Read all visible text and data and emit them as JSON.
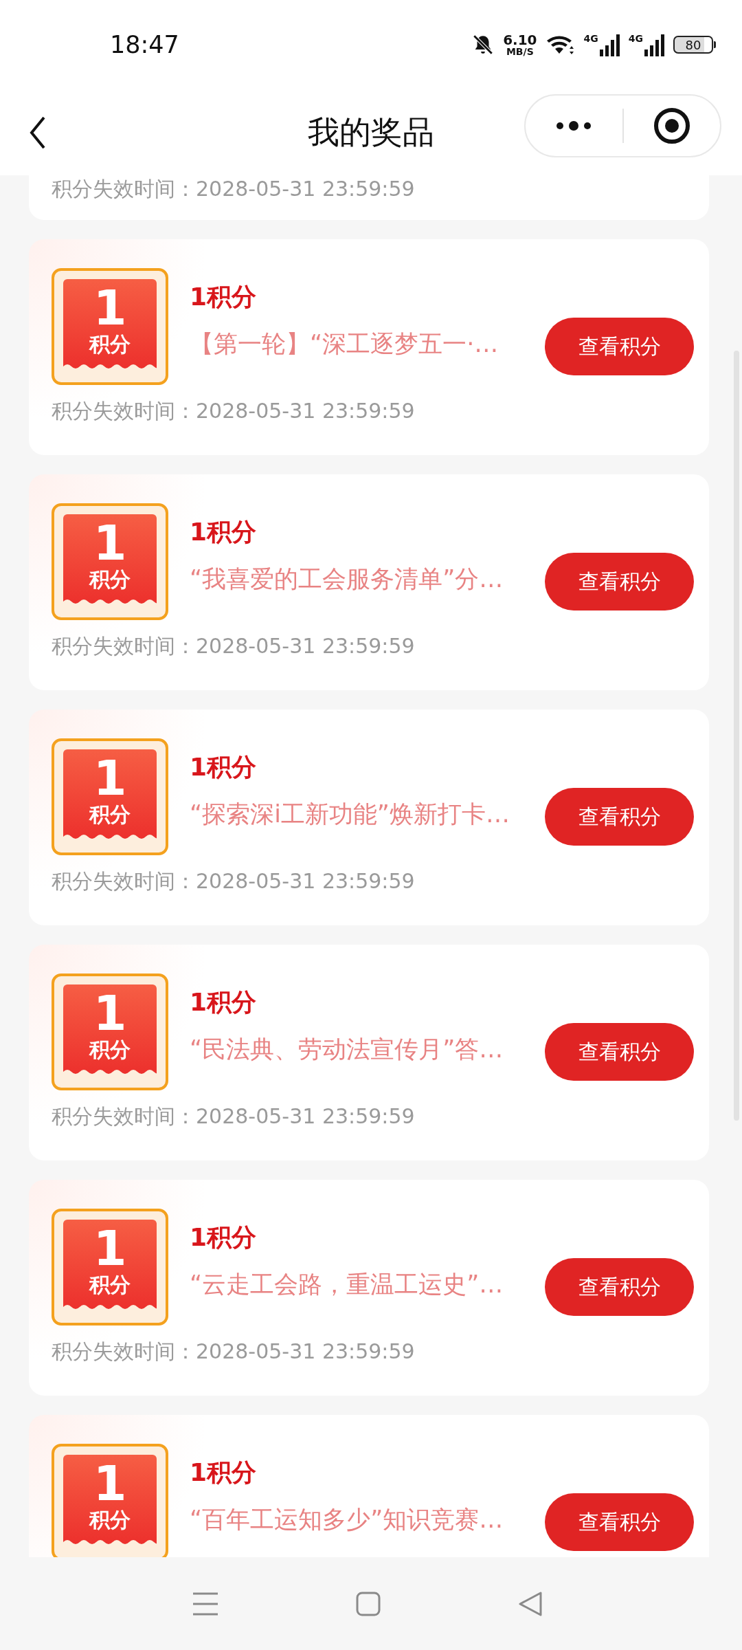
{
  "status_bar": {
    "time": "18:47",
    "net_speed": "6.10",
    "net_unit": "MB/S",
    "signals": [
      {
        "label": "4G"
      },
      {
        "label": "4G"
      }
    ],
    "battery": "80"
  },
  "header": {
    "title": "我的奖品"
  },
  "partial_card": {
    "expiry": "积分失效时间：2028-05-31 23:59:59"
  },
  "prizes": [
    {
      "badge_value": "1",
      "badge_unit": "积分",
      "points": "1积分",
      "title": "【第一轮】“深工逐梦五一·…",
      "button": "查看积分",
      "expiry": "积分失效时间：2028-05-31 23:59:59"
    },
    {
      "badge_value": "1",
      "badge_unit": "积分",
      "points": "1积分",
      "title": "“我喜爱的工会服务清单”分…",
      "button": "查看积分",
      "expiry": "积分失效时间：2028-05-31 23:59:59"
    },
    {
      "badge_value": "1",
      "badge_unit": "积分",
      "points": "1积分",
      "title": "“探索深i工新功能”焕新打卡…",
      "button": "查看积分",
      "expiry": "积分失效时间：2028-05-31 23:59:59"
    },
    {
      "badge_value": "1",
      "badge_unit": "积分",
      "points": "1积分",
      "title": "“民法典、劳动法宣传月”答…",
      "button": "查看积分",
      "expiry": "积分失效时间：2028-05-31 23:59:59"
    },
    {
      "badge_value": "1",
      "badge_unit": "积分",
      "points": "1积分",
      "title": "“云走工会路，重温工运史”…",
      "button": "查看积分",
      "expiry": "积分失效时间：2028-05-31 23:59:59"
    },
    {
      "badge_value": "1",
      "badge_unit": "积分",
      "points": "1积分",
      "title": "“百年工运知多少”知识竞赛…",
      "button": "查看积分"
    }
  ]
}
